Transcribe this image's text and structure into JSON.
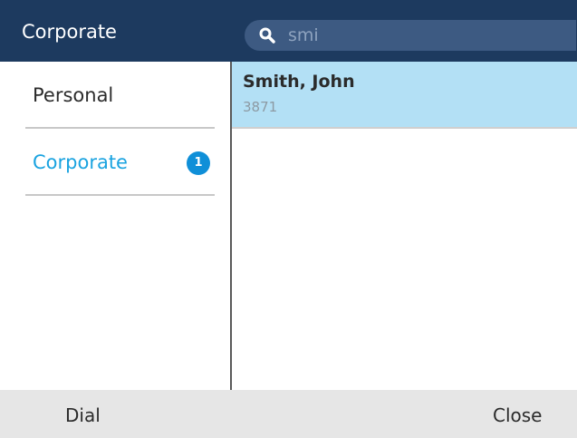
{
  "header": {
    "title": "Corporate",
    "search": {
      "icon": "search-icon",
      "value": "smi"
    }
  },
  "sidebar": {
    "items": [
      {
        "label": "Personal",
        "active": false
      },
      {
        "label": "Corporate",
        "active": true,
        "badge": "1"
      }
    ]
  },
  "results": [
    {
      "name": "Smith, John",
      "number": "3871",
      "selected": true
    }
  ],
  "softkeys": {
    "left": "Dial",
    "right": "Close"
  },
  "colors": {
    "header_bg": "#1d3a5f",
    "search_bg": "#3d5a82",
    "accent": "#1aa3e0",
    "badge": "#0f8fd8",
    "selected_row": "#b3e0f5",
    "softkey_bar": "#e6e6e6"
  }
}
